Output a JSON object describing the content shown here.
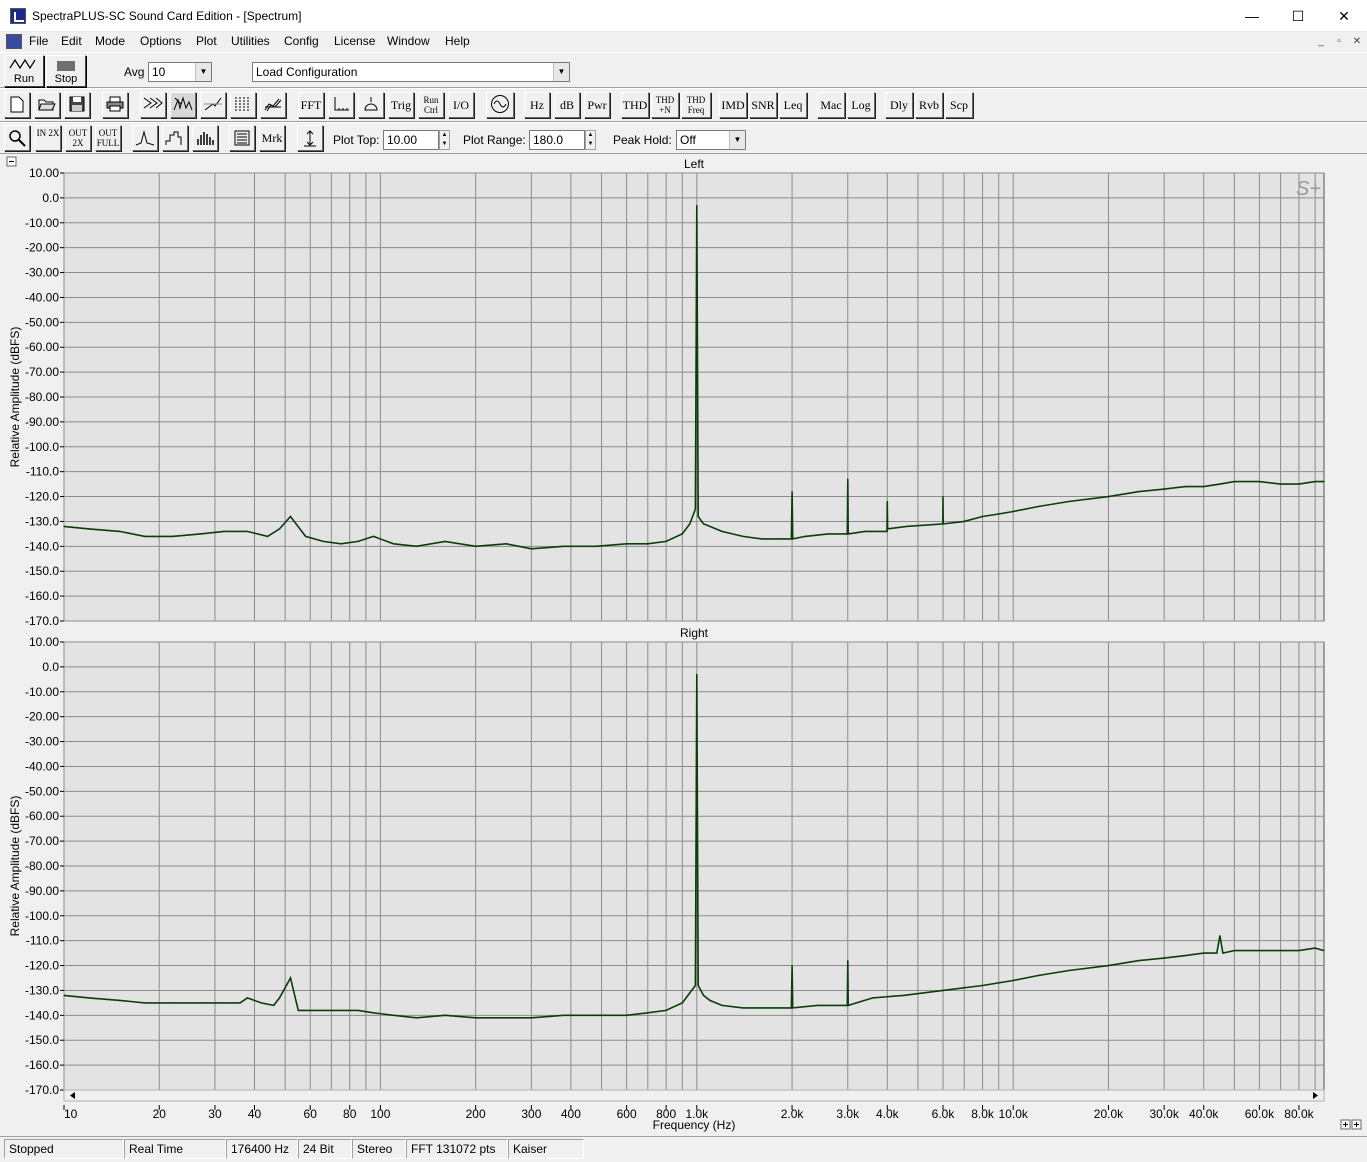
{
  "window": {
    "title": "SpectraPLUS-SC Sound Card Edition - [Spectrum]",
    "minimize_glyph": "—",
    "maximize_glyph": "☐",
    "close_glyph": "✕"
  },
  "menu": [
    "File",
    "Edit",
    "Mode",
    "Options",
    "Plot",
    "Utilities",
    "Config",
    "License",
    "Window",
    "Help"
  ],
  "mdi_controls": [
    "_",
    "▫",
    "✕"
  ],
  "toolbar1": {
    "run_label": "Run",
    "stop_label": "Stop",
    "avg_label": "Avg",
    "avg_value": "10",
    "config_value": "Load Configuration"
  },
  "toolbar2": {
    "text_buttons": [
      "FFT",
      "Trig",
      "Run Ctrl",
      "I/O",
      "Hz",
      "dB",
      "Pwr",
      "THD",
      "THD +N",
      "THD Freq",
      "IMD",
      "SNR",
      "Leq",
      "Mac",
      "Log",
      "Dly",
      "Rvb",
      "Scp"
    ]
  },
  "toolbar3": {
    "zoom_in_label": "IN 2X",
    "zoom_out_label": "OUT 2X",
    "zoom_full_label": "OUT FULL",
    "marker_label": "Mrk",
    "plot_top_label": "Plot Top:",
    "plot_top_value": "10.00",
    "plot_range_label": "Plot Range:",
    "plot_range_value": "180.0",
    "peak_hold_label": "Peak Hold:",
    "peak_hold_value": "Off"
  },
  "colors": {
    "plot_bg": "#e3e3e3",
    "grid": "#8c8c8c",
    "trace": "#0b3d0b"
  },
  "chart_data": [
    {
      "type": "line",
      "title": "Left",
      "xlabel": "Frequency (Hz)",
      "ylabel": "Relative Amplitude (dBFS)",
      "x_scale": "log",
      "xlim": [
        10,
        96000
      ],
      "ylim": [
        -170,
        10
      ],
      "y_ticks": [
        "10.00",
        "0.0",
        "-10.00",
        "-20.00",
        "-30.00",
        "-40.00",
        "-50.00",
        "-60.00",
        "-70.00",
        "-80.00",
        "-90.00",
        "-100.0",
        "-110.0",
        "-120.0",
        "-130.0",
        "-140.0",
        "-150.0",
        "-160.0",
        "-170.0"
      ],
      "watermark": "S+",
      "series": [
        {
          "x": [
            10,
            12,
            15,
            18,
            22,
            27,
            32,
            38,
            44,
            48,
            52,
            58,
            66,
            75,
            85,
            95,
            110,
            130,
            160,
            200,
            250,
            300,
            380,
            480,
            600,
            700,
            800,
            900,
            950,
            990,
            1000,
            1010,
            1050,
            1100,
            1200,
            1400,
            1600,
            1800,
            1990,
            2000,
            2010,
            2200,
            2600,
            2990,
            3000,
            3010,
            3400,
            3990,
            4000,
            4010,
            4600,
            5990,
            6000,
            6010,
            7000,
            8000,
            9000,
            10000,
            12000,
            15000,
            20000,
            25000,
            30000,
            35000,
            40000,
            45000,
            50000,
            60000,
            70000,
            80000,
            90000,
            96000
          ],
          "y": [
            -132,
            -133,
            -134,
            -136,
            -136,
            -135,
            -134,
            -134,
            -136,
            -133,
            -128,
            -136,
            -138,
            -139,
            -138,
            -136,
            -139,
            -140,
            -138,
            -140,
            -139,
            -141,
            -140,
            -140,
            -139,
            -139,
            -138,
            -135,
            -131,
            -125,
            -3,
            -128,
            -131,
            -132,
            -134,
            -136,
            -137,
            -137,
            -137,
            -118,
            -137,
            -136,
            -135,
            -135,
            -113,
            -135,
            -134,
            -134,
            -122,
            -133,
            -132,
            -131,
            -120,
            -131,
            -130,
            -128,
            -127,
            -126,
            -124,
            -122,
            -120,
            -118,
            -117,
            -116,
            -116,
            -115,
            -114,
            -114,
            -115,
            -115,
            -114,
            -114
          ]
        }
      ]
    },
    {
      "type": "line",
      "title": "Right",
      "xlabel": "Frequency (Hz)",
      "ylabel": "Relative Amplitude (dBFS)",
      "x_scale": "log",
      "xlim": [
        10,
        96000
      ],
      "ylim": [
        -170,
        10
      ],
      "x_ticks": [
        "10",
        "20",
        "30",
        "40",
        "60",
        "80",
        "100",
        "200",
        "300",
        "400",
        "600",
        "800",
        "1.0k",
        "2.0k",
        "3.0k",
        "4.0k",
        "6.0k",
        "8.0k",
        "10.0k",
        "20.0k",
        "30.0k",
        "40.0k",
        "60.0k",
        "80.0k"
      ],
      "series": [
        {
          "x": [
            10,
            12,
            15,
            18,
            22,
            27,
            32,
            36,
            38,
            42,
            46,
            48,
            52,
            55,
            60,
            70,
            85,
            95,
            110,
            130,
            160,
            200,
            250,
            300,
            380,
            480,
            600,
            700,
            800,
            900,
            950,
            990,
            1000,
            1010,
            1050,
            1100,
            1200,
            1400,
            1600,
            1800,
            1990,
            2000,
            2010,
            2400,
            2990,
            3000,
            3010,
            3600,
            4500,
            6000,
            8000,
            10000,
            12000,
            15000,
            20000,
            25000,
            30000,
            35000,
            40000,
            44000,
            45000,
            46000,
            50000,
            60000,
            70000,
            80000,
            90000,
            96000
          ],
          "y": [
            -132,
            -133,
            -134,
            -135,
            -135,
            -135,
            -135,
            -135,
            -133,
            -135,
            -136,
            -133,
            -125,
            -138,
            -138,
            -138,
            -138,
            -139,
            -140,
            -141,
            -140,
            -141,
            -141,
            -141,
            -140,
            -140,
            -140,
            -139,
            -138,
            -135,
            -131,
            -128,
            -3,
            -128,
            -132,
            -134,
            -136,
            -137,
            -137,
            -137,
            -137,
            -120,
            -137,
            -136,
            -136,
            -118,
            -136,
            -133,
            -132,
            -130,
            -128,
            -126,
            -124,
            -122,
            -120,
            -118,
            -117,
            -116,
            -115,
            -115,
            -108,
            -115,
            -114,
            -114,
            -114,
            -114,
            -113,
            -114
          ]
        }
      ]
    }
  ],
  "statusbar": [
    "Stopped",
    "Real Time",
    "176400 Hz",
    "24 Bit",
    "Stereo",
    "FFT 131072 pts",
    "Kaiser"
  ]
}
